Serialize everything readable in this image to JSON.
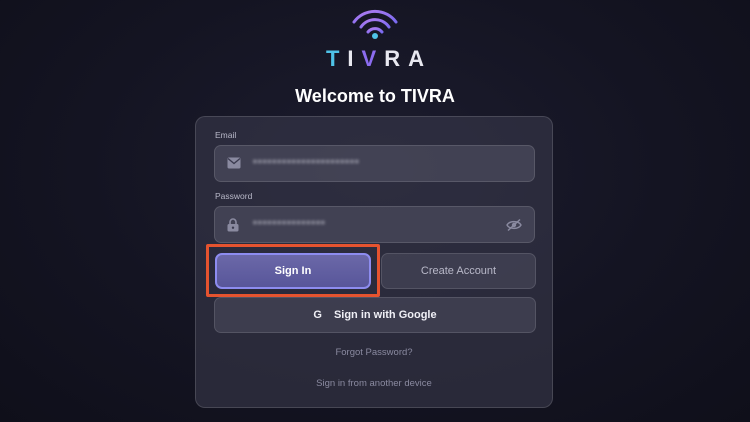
{
  "brand": {
    "letters": [
      "T",
      "I",
      "V",
      "R",
      "A"
    ],
    "icon": "wifi-signal-icon",
    "colors": {
      "accent_blue": "#4fc3e8",
      "accent_purple": "#8b6cf0",
      "highlight": "#e5532f"
    }
  },
  "header": {
    "welcome": "Welcome to TIVRA"
  },
  "form": {
    "email": {
      "label": "Email",
      "icon": "mail-icon",
      "value": "••••••••••••••••••••••"
    },
    "password": {
      "label": "Password",
      "icon": "lock-icon",
      "value": "•••••••••••••••",
      "toggle_icon": "eye-off-icon"
    },
    "sign_in_label": "Sign In",
    "create_account_label": "Create Account",
    "google": {
      "icon": "G",
      "label": "Sign in with Google"
    },
    "forgot_password": "Forgot Password?",
    "other_device": "Sign in from another device"
  }
}
